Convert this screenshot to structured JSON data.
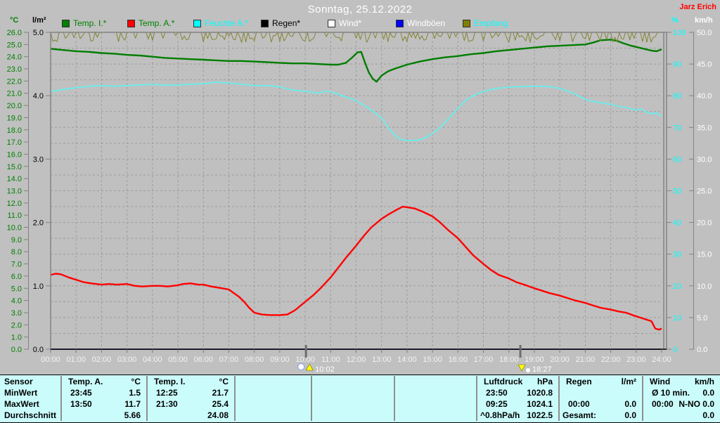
{
  "header": {
    "title": "Sonntag, 25.12.2022",
    "owner": "Jarz Erich"
  },
  "axis_headers": {
    "temp": "°C",
    "rain": "l/m²",
    "humidity": "%",
    "wind": "km/h"
  },
  "legend": [
    {
      "label": "Temp. I.*",
      "box": "#008000",
      "text": "#008000",
      "x": 88
    },
    {
      "label": "Temp. A.*",
      "box": "#ff0000",
      "text": "#008000",
      "x": 181
    },
    {
      "label": "Feuchte A.*",
      "box": "#00ffff",
      "text": "#00ffff",
      "x": 275
    },
    {
      "label": "Regen*",
      "box": "#000000",
      "text": "#000000",
      "x": 371
    },
    {
      "label": "Wind*",
      "box": "#ffffff",
      "text": "#ffffff",
      "x": 466
    },
    {
      "label": "Windböen",
      "box": "#0000ff",
      "text": "#ffffff",
      "x": 563
    },
    {
      "label": "Empfang",
      "box": "#808000",
      "text": "#00ffff",
      "x": 658
    }
  ],
  "chart_data": {
    "type": "line",
    "x_axis": {
      "unit": "time",
      "range_hours": [
        0,
        24
      ],
      "tick_every_hours": 1,
      "labels": [
        "00:00",
        "01:00",
        "02:00",
        "03:00",
        "04:00",
        "05:00",
        "06:00",
        "07:00",
        "08:00",
        "09:00",
        "10:00",
        "11:00",
        "12:00",
        "13:00",
        "14:00",
        "15:00",
        "16:00",
        "17:00",
        "18:00",
        "19:00",
        "20:00",
        "21:00",
        "22:00",
        "23:00",
        "24:00"
      ]
    },
    "y_axes": [
      {
        "id": "temp_c",
        "label": "°C",
        "min": 0,
        "max": 26,
        "step": 1,
        "color": "#008000",
        "side": "left"
      },
      {
        "id": "rain_lm2",
        "label": "l/m²",
        "min": 0,
        "max": 5,
        "step": 1,
        "color": "#000000",
        "side": "left"
      },
      {
        "id": "hum_pct",
        "label": "%",
        "min": 0,
        "max": 100,
        "step": 10,
        "color": "#00ffff",
        "side": "right"
      },
      {
        "id": "wind_kmh",
        "label": "km/h",
        "min": 0,
        "max": 50,
        "step": 5,
        "color": "#ffffff",
        "side": "right"
      }
    ],
    "grid": {
      "vertical_every_hours": 1,
      "horizontal_divisions": 20,
      "style": "dashed"
    },
    "markers": [
      {
        "time": "10:02",
        "t": 10.03,
        "dir": "up"
      },
      {
        "time": "18:27",
        "t": 18.45,
        "dir": "down"
      }
    ],
    "series": [
      {
        "name": "Temp. I.",
        "axis": "temp_c",
        "color": "#007d00",
        "width": 2.4,
        "points": [
          [
            0,
            24.65
          ],
          [
            0.5,
            24.55
          ],
          [
            1,
            24.45
          ],
          [
            1.5,
            24.4
          ],
          [
            2,
            24.3
          ],
          [
            2.5,
            24.25
          ],
          [
            3,
            24.15
          ],
          [
            3.5,
            24.1
          ],
          [
            4,
            24.0
          ],
          [
            4.5,
            23.9
          ],
          [
            5,
            23.85
          ],
          [
            5.5,
            23.8
          ],
          [
            6,
            23.75
          ],
          [
            6.5,
            23.7
          ],
          [
            7,
            23.65
          ],
          [
            7.5,
            23.65
          ],
          [
            8,
            23.6
          ],
          [
            8.5,
            23.55
          ],
          [
            9,
            23.5
          ],
          [
            9.5,
            23.45
          ],
          [
            10,
            23.45
          ],
          [
            10.5,
            23.4
          ],
          [
            11,
            23.35
          ],
          [
            11.3,
            23.35
          ],
          [
            11.6,
            23.5
          ],
          [
            11.85,
            23.95
          ],
          [
            12.05,
            24.35
          ],
          [
            12.2,
            24.4
          ],
          [
            12.35,
            23.5
          ],
          [
            12.5,
            22.7
          ],
          [
            12.65,
            22.2
          ],
          [
            12.8,
            21.95
          ],
          [
            13,
            22.45
          ],
          [
            13.25,
            22.8
          ],
          [
            13.5,
            23.0
          ],
          [
            14,
            23.35
          ],
          [
            14.5,
            23.6
          ],
          [
            15,
            23.8
          ],
          [
            15.5,
            23.95
          ],
          [
            16,
            24.05
          ],
          [
            16.5,
            24.2
          ],
          [
            17,
            24.3
          ],
          [
            17.5,
            24.45
          ],
          [
            18,
            24.55
          ],
          [
            18.5,
            24.65
          ],
          [
            19,
            24.75
          ],
          [
            19.5,
            24.85
          ],
          [
            20,
            24.9
          ],
          [
            20.5,
            24.95
          ],
          [
            21,
            25.0
          ],
          [
            21.3,
            25.15
          ],
          [
            21.6,
            25.35
          ],
          [
            22,
            25.4
          ],
          [
            22.25,
            25.3
          ],
          [
            22.5,
            25.1
          ],
          [
            22.8,
            24.9
          ],
          [
            23,
            24.8
          ],
          [
            23.3,
            24.65
          ],
          [
            23.6,
            24.5
          ],
          [
            23.8,
            24.45
          ],
          [
            24,
            24.6
          ]
        ]
      },
      {
        "name": "Temp. A.",
        "axis": "temp_c",
        "color": "#ff0000",
        "width": 2.4,
        "points": [
          [
            0,
            6.1
          ],
          [
            0.2,
            6.2
          ],
          [
            0.4,
            6.15
          ],
          [
            0.7,
            5.9
          ],
          [
            1,
            5.7
          ],
          [
            1.3,
            5.5
          ],
          [
            1.6,
            5.4
          ],
          [
            2,
            5.3
          ],
          [
            2.3,
            5.35
          ],
          [
            2.6,
            5.3
          ],
          [
            3,
            5.35
          ],
          [
            3.3,
            5.2
          ],
          [
            3.6,
            5.15
          ],
          [
            4,
            5.2
          ],
          [
            4.3,
            5.2
          ],
          [
            4.6,
            5.15
          ],
          [
            5,
            5.25
          ],
          [
            5.2,
            5.35
          ],
          [
            5.5,
            5.4
          ],
          [
            5.8,
            5.3
          ],
          [
            6,
            5.3
          ],
          [
            6.3,
            5.15
          ],
          [
            6.6,
            5.05
          ],
          [
            7,
            4.9
          ],
          [
            7.2,
            4.6
          ],
          [
            7.4,
            4.3
          ],
          [
            7.6,
            3.9
          ],
          [
            7.8,
            3.4
          ],
          [
            8,
            3.0
          ],
          [
            8.3,
            2.85
          ],
          [
            8.6,
            2.8
          ],
          [
            9,
            2.8
          ],
          [
            9.3,
            2.85
          ],
          [
            9.6,
            3.2
          ],
          [
            10,
            3.9
          ],
          [
            10.3,
            4.4
          ],
          [
            10.6,
            5.0
          ],
          [
            11,
            5.9
          ],
          [
            11.3,
            6.7
          ],
          [
            11.6,
            7.5
          ],
          [
            12,
            8.5
          ],
          [
            12.3,
            9.3
          ],
          [
            12.6,
            10.0
          ],
          [
            13,
            10.7
          ],
          [
            13.3,
            11.1
          ],
          [
            13.6,
            11.45
          ],
          [
            13.83,
            11.7
          ],
          [
            14,
            11.65
          ],
          [
            14.3,
            11.55
          ],
          [
            14.6,
            11.3
          ],
          [
            15,
            10.9
          ],
          [
            15.3,
            10.4
          ],
          [
            15.6,
            9.8
          ],
          [
            16,
            9.1
          ],
          [
            16.3,
            8.4
          ],
          [
            16.6,
            7.7
          ],
          [
            17,
            7.0
          ],
          [
            17.3,
            6.5
          ],
          [
            17.6,
            6.1
          ],
          [
            18,
            5.8
          ],
          [
            18.3,
            5.5
          ],
          [
            18.6,
            5.3
          ],
          [
            19,
            5.0
          ],
          [
            19.3,
            4.8
          ],
          [
            19.6,
            4.6
          ],
          [
            20,
            4.4
          ],
          [
            20.3,
            4.2
          ],
          [
            20.6,
            4.0
          ],
          [
            21,
            3.8
          ],
          [
            21.3,
            3.6
          ],
          [
            21.6,
            3.4
          ],
          [
            22,
            3.25
          ],
          [
            22.3,
            3.1
          ],
          [
            22.6,
            3.0
          ],
          [
            23,
            2.7
          ],
          [
            23.3,
            2.5
          ],
          [
            23.6,
            2.3
          ],
          [
            23.75,
            1.7
          ],
          [
            23.9,
            1.6
          ],
          [
            24,
            1.7
          ]
        ]
      },
      {
        "name": "Feuchte A.",
        "axis": "hum_pct",
        "color": "#5ff2f2",
        "width": 1.6,
        "points": [
          [
            0,
            81.3
          ],
          [
            0.5,
            82.0
          ],
          [
            1,
            82.5
          ],
          [
            1.5,
            83.0
          ],
          [
            2,
            83.2
          ],
          [
            2.5,
            83.0
          ],
          [
            3,
            83.2
          ],
          [
            3.5,
            83.4
          ],
          [
            4,
            83.6
          ],
          [
            4.5,
            83.3
          ],
          [
            5,
            83.4
          ],
          [
            5.5,
            83.6
          ],
          [
            6,
            83.8
          ],
          [
            6.5,
            84.3
          ],
          [
            7,
            84.0
          ],
          [
            7.5,
            83.6
          ],
          [
            8,
            83.2
          ],
          [
            8.5,
            83.2
          ],
          [
            9,
            82.8
          ],
          [
            9.5,
            81.8
          ],
          [
            10,
            81.4
          ],
          [
            10.5,
            80.8
          ],
          [
            10.8,
            81.4
          ],
          [
            11,
            81.2
          ],
          [
            11.5,
            79.9
          ],
          [
            12,
            78.5
          ],
          [
            12.5,
            76.0
          ],
          [
            13,
            73.0
          ],
          [
            13.3,
            69.5
          ],
          [
            13.6,
            67.0
          ],
          [
            13.8,
            66.1
          ],
          [
            14,
            65.9
          ],
          [
            14.3,
            65.8
          ],
          [
            14.6,
            66.3
          ],
          [
            15,
            68.0
          ],
          [
            15.3,
            70.0
          ],
          [
            15.6,
            72.5
          ],
          [
            16,
            76.0
          ],
          [
            16.3,
            78.5
          ],
          [
            16.6,
            80.0
          ],
          [
            17,
            81.3
          ],
          [
            17.5,
            82.3
          ],
          [
            18,
            82.7
          ],
          [
            18.5,
            82.9
          ],
          [
            19,
            82.9
          ],
          [
            19.3,
            83.0
          ],
          [
            19.6,
            82.9
          ],
          [
            20,
            82.3
          ],
          [
            20.3,
            81.5
          ],
          [
            20.6,
            80.5
          ],
          [
            21,
            78.8
          ],
          [
            21.3,
            78.2
          ],
          [
            21.6,
            77.8
          ],
          [
            22,
            77.3
          ],
          [
            22.3,
            76.6
          ],
          [
            22.6,
            76.3
          ],
          [
            23,
            75.4
          ],
          [
            23.2,
            75.8
          ],
          [
            23.4,
            74.8
          ],
          [
            23.6,
            74.3
          ],
          [
            23.8,
            74.6
          ],
          [
            24,
            73.5
          ]
        ]
      },
      {
        "name": "Regen",
        "axis": "rain_lm2",
        "color": "#000000",
        "width": 1.5,
        "constant": 0
      },
      {
        "name": "Wind",
        "axis": "wind_kmh",
        "color": "#ffffff",
        "width": 1.2,
        "constant": 0
      },
      {
        "name": "Windböen",
        "axis": "wind_kmh",
        "color": "#0000ff",
        "width": 1.2,
        "constant": 0
      },
      {
        "name": "Empfang",
        "axis": "hum_pct",
        "color": "#848434",
        "width": 1,
        "noise": {
          "baseline": 100,
          "dip_max": 3.2,
          "points_per_hour": 12
        }
      }
    ]
  },
  "table": {
    "row_labels": [
      "Sensor",
      "MinWert",
      "MaxWert",
      "Durchschnitt"
    ],
    "columns": [
      {
        "name": "Temp. A.",
        "unit": "°C",
        "cells": [
          [
            "23:45",
            "1.5"
          ],
          [
            "13:50",
            "11.7"
          ],
          [
            "",
            "5.66"
          ]
        ]
      },
      {
        "name": "Temp. I.",
        "unit": "°C",
        "cells": [
          [
            "12:25",
            "21.7"
          ],
          [
            "21:30",
            "25.4"
          ],
          [
            "",
            "24.08"
          ]
        ]
      },
      null,
      null,
      null,
      {
        "name": "Luftdruck",
        "unit": "hPa",
        "cells": [
          [
            "23:50",
            "1020.8"
          ],
          [
            "09:25",
            "1024.1"
          ],
          [
            "^0.8hPa/h",
            "1022.5"
          ]
        ]
      },
      {
        "name": "Regen",
        "unit": "l/m²",
        "cells": [
          [
            "",
            ""
          ],
          [
            "00:00",
            "0.0"
          ],
          [
            "Gesamt:",
            "0.0"
          ]
        ]
      },
      {
        "name": "Wind",
        "unit": "km/h",
        "cells": [
          [
            "Ø 10 min.",
            "0.0"
          ],
          [
            "00:00",
            "N-NO 0.0"
          ],
          [
            "",
            "0.0"
          ]
        ]
      }
    ]
  }
}
